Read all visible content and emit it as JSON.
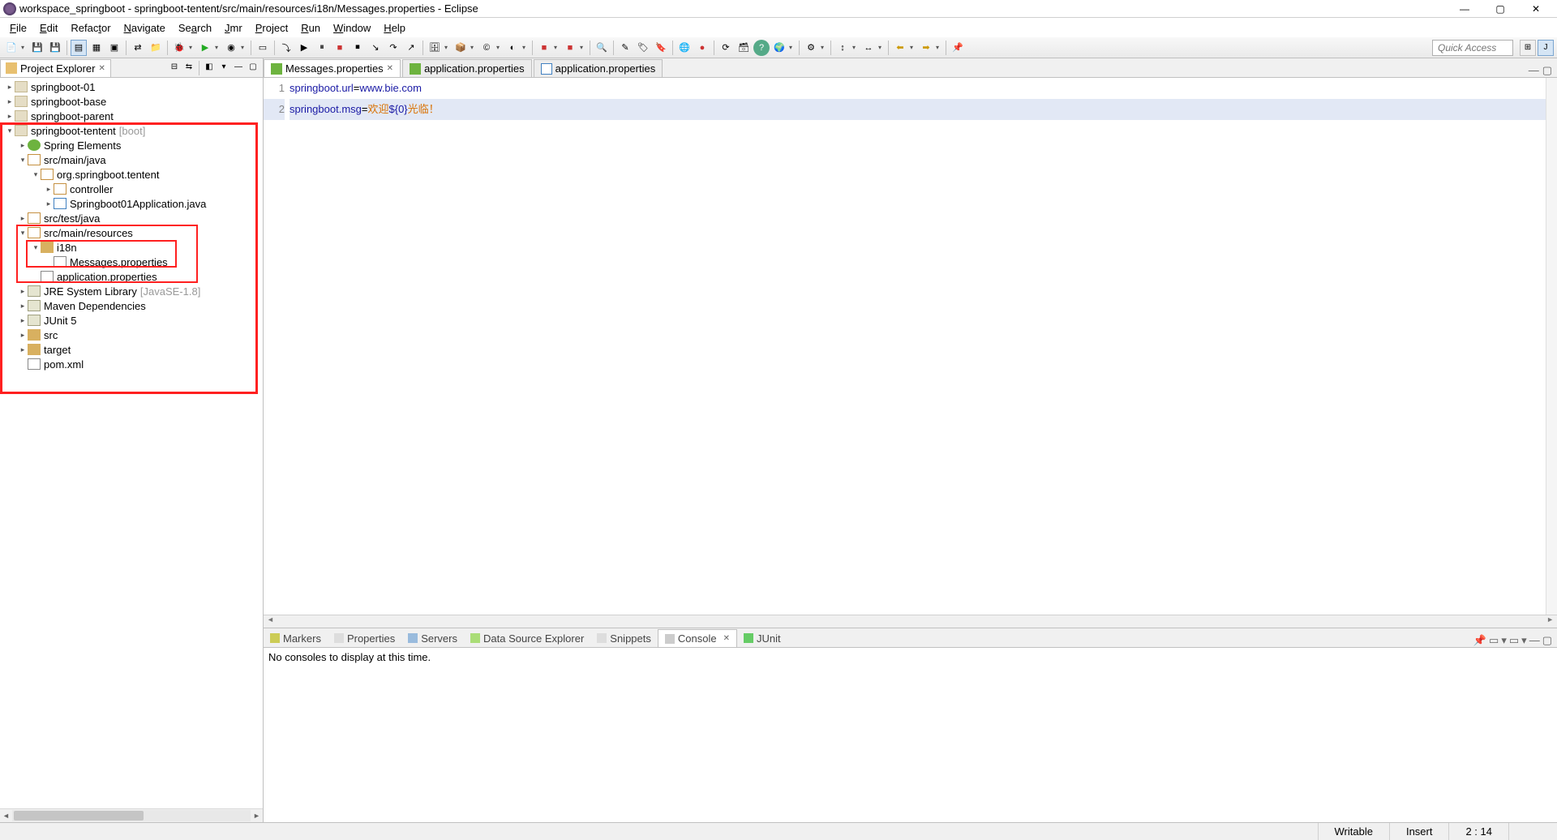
{
  "window": {
    "title": "workspace_springboot - springboot-tentent/src/main/resources/i18n/Messages.properties - Eclipse"
  },
  "menu": [
    "File",
    "Edit",
    "Refactor",
    "Navigate",
    "Search",
    "Jmr",
    "Project",
    "Run",
    "Window",
    "Help"
  ],
  "quick_access_placeholder": "Quick Access",
  "explorer": {
    "title": "Project Explorer",
    "items": {
      "p1": "springboot-01",
      "p2": "springboot-base",
      "p3": "springboot-parent",
      "p4": "springboot-tentent",
      "p4_extra": "[boot]",
      "p4_spring": "Spring Elements",
      "p4_smj": "src/main/java",
      "p4_pkg": "org.springboot.tentent",
      "p4_ctrl": "controller",
      "p4_app": "Springboot01Application.java",
      "p4_stj": "src/test/java",
      "p4_smr": "src/main/resources",
      "p4_i18n": "i18n",
      "p4_msg": "Messages.properties",
      "p4_appprop": "application.properties",
      "p4_jre": "JRE System Library",
      "p4_jre_extra": "[JavaSE-1.8]",
      "p4_maven": "Maven Dependencies",
      "p4_junit": "JUnit 5",
      "p4_src": "src",
      "p4_target": "target",
      "p4_pom": "pom.xml"
    }
  },
  "editor": {
    "tabs": {
      "t1": "Messages.properties",
      "t2": "application.properties",
      "t3": "application.properties"
    },
    "lines": {
      "l1_key": "springboot.url",
      "l1_val": "www.bie.com",
      "l2_key": "springboot.msg",
      "l2_val_a": "欢迎",
      "l2_val_b": "${0}",
      "l2_val_c": "光临！"
    },
    "line_numbers": {
      "n1": "1",
      "n2": "2"
    }
  },
  "bottom": {
    "tabs": {
      "markers": "Markers",
      "properties": "Properties",
      "servers": "Servers",
      "dse": "Data Source Explorer",
      "snippets": "Snippets",
      "console": "Console",
      "junit": "JUnit"
    },
    "console_msg": "No consoles to display at this time."
  },
  "status": {
    "writable": "Writable",
    "insert": "Insert",
    "pos": "2 : 14"
  }
}
